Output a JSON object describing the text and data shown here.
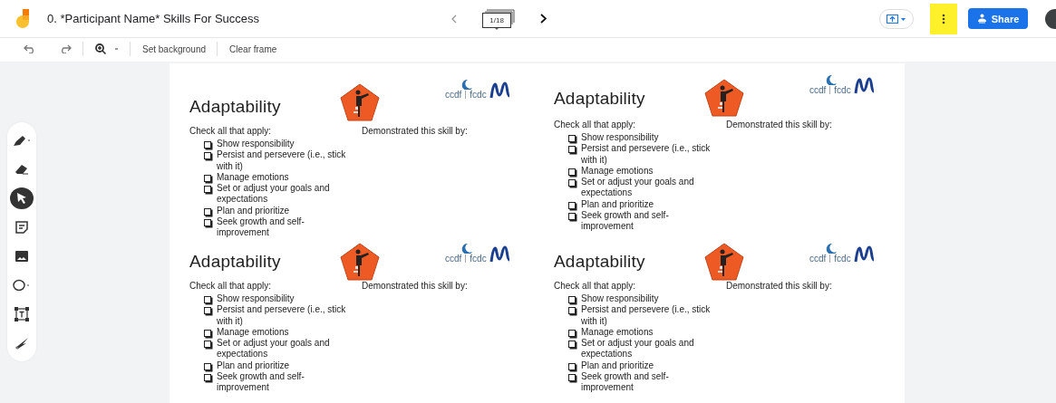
{
  "app": {
    "title": "0. *Participant Name* Skills For Success"
  },
  "frame_nav": {
    "counter": "1/18"
  },
  "more_button": {
    "highlighted": true
  },
  "share_button": {
    "label": "Share"
  },
  "toolbar": [
    {
      "kind": "undo"
    },
    {
      "kind": "redo"
    },
    {
      "kind": "zoom"
    },
    {
      "kind": "text",
      "label": "Set background"
    },
    {
      "kind": "text",
      "label": "Clear frame"
    }
  ],
  "tools": [
    {
      "kind": "pen",
      "selected": false
    },
    {
      "kind": "eraser",
      "selected": false
    },
    {
      "kind": "select",
      "selected": true
    },
    {
      "kind": "sticky",
      "selected": false
    },
    {
      "kind": "image",
      "selected": false
    },
    {
      "kind": "circle",
      "selected": false
    },
    {
      "kind": "textbox",
      "selected": false
    },
    {
      "kind": "laser",
      "selected": false
    }
  ],
  "cards": [
    {
      "title": "Adaptability",
      "check_label": "Check all that apply:",
      "demonstrated_label": "Demonstrated this skill by:",
      "logo_left": "ccdf",
      "logo_right": "fcdc",
      "items": [
        {
          "label": "Show responsibility",
          "checked": false
        },
        {
          "label": "Persist and persevere (i.e., stick with it)",
          "checked": false
        },
        {
          "label": "Manage emotions",
          "checked": false
        },
        {
          "label": "Set or adjust your goals and expectations",
          "checked": false
        },
        {
          "label": "Plan and prioritize",
          "checked": false
        },
        {
          "label": "Seek growth and self-improvement",
          "checked": false
        }
      ]
    },
    {
      "title": "Adaptability",
      "check_label": "Check all that apply:",
      "demonstrated_label": "Demonstrated this skill by:",
      "logo_left": "ccdf",
      "logo_right": "fcdc",
      "items": [
        {
          "label": "Show responsibility",
          "checked": false
        },
        {
          "label": "Persist and persevere (i.e., stick with it)",
          "checked": false
        },
        {
          "label": "Manage emotions",
          "checked": false
        },
        {
          "label": "Set or adjust your goals and expectations",
          "checked": false
        },
        {
          "label": "Plan and prioritize",
          "checked": false
        },
        {
          "label": "Seek growth and self-improvement",
          "checked": false
        }
      ]
    },
    {
      "title": "Adaptability",
      "check_label": "Check all that apply:",
      "demonstrated_label": "Demonstrated this skill by:",
      "logo_left": "ccdf",
      "logo_right": "fcdc",
      "items": [
        {
          "label": "Show responsibility",
          "checked": false
        },
        {
          "label": "Persist and persevere (i.e., stick with it)",
          "checked": false
        },
        {
          "label": "Manage emotions",
          "checked": false
        },
        {
          "label": "Set or adjust your goals and expectations",
          "checked": false
        },
        {
          "label": "Plan and prioritize",
          "checked": false
        },
        {
          "label": "Seek growth and self-improvement",
          "checked": false
        }
      ]
    },
    {
      "title": "Adaptability",
      "check_label": "Check all that apply:",
      "demonstrated_label": "Demonstrated this skill by:",
      "logo_left": "ccdf",
      "logo_right": "fcdc",
      "items": [
        {
          "label": "Show responsibility",
          "checked": false
        },
        {
          "label": "Persist and persevere (i.e., stick with it)",
          "checked": false
        },
        {
          "label": "Manage emotions",
          "checked": false
        },
        {
          "label": "Set or adjust your goals and expectations",
          "checked": false
        },
        {
          "label": "Plan and prioritize",
          "checked": false
        },
        {
          "label": "Seek growth and self-improvement",
          "checked": false
        }
      ]
    }
  ]
}
